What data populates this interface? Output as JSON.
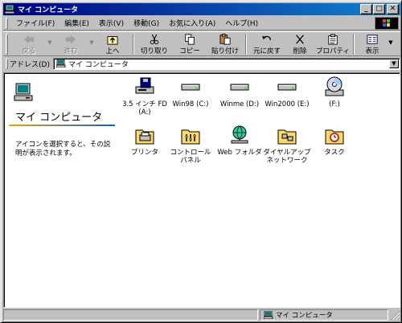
{
  "window": {
    "title": "マイ コンピュータ",
    "controls": {
      "minimize": "_",
      "maximize": "□",
      "close": "✕"
    }
  },
  "menu": [
    "ファイル(F)",
    "編集(E)",
    "表示(V)",
    "移動(G)",
    "お気に入り(A)",
    "ヘルプ(H)"
  ],
  "toolbar": {
    "back": "戻る",
    "forward": "進む",
    "up": "上へ",
    "cut": "切り取り",
    "copy": "コピー",
    "paste": "貼り付け",
    "undo": "元に戻す",
    "delete": "削除",
    "properties": "プロパティ",
    "views": "表示"
  },
  "address": {
    "label": "アドレス(D)",
    "value": "マイ コンピュータ"
  },
  "left_pane": {
    "title": "マイ コンピュータ",
    "description": "アイコンを選択すると、その説明が表示されます。"
  },
  "items": [
    {
      "label": "3.5 インチ FD\n(A:)",
      "icon": "floppy-drive-icon"
    },
    {
      "label": "Win98 (C:)",
      "icon": "hard-drive-icon"
    },
    {
      "label": "Winme (D:)",
      "icon": "hard-drive-icon"
    },
    {
      "label": "Win2000 (E:)",
      "icon": "hard-drive-icon"
    },
    {
      "label": "(F:)",
      "icon": "cd-drive-icon"
    },
    {
      "label": "プリンタ",
      "icon": "printers-folder-icon"
    },
    {
      "label": "コントロール\nパネル",
      "icon": "control-panel-icon"
    },
    {
      "label": "Web フォルダ",
      "icon": "web-folders-icon"
    },
    {
      "label": "ダイヤルアップ\nネットワーク",
      "icon": "dialup-networking-icon"
    },
    {
      "label": "タスク",
      "icon": "scheduled-tasks-icon"
    }
  ],
  "status": {
    "location": "マイ コンピュータ"
  }
}
